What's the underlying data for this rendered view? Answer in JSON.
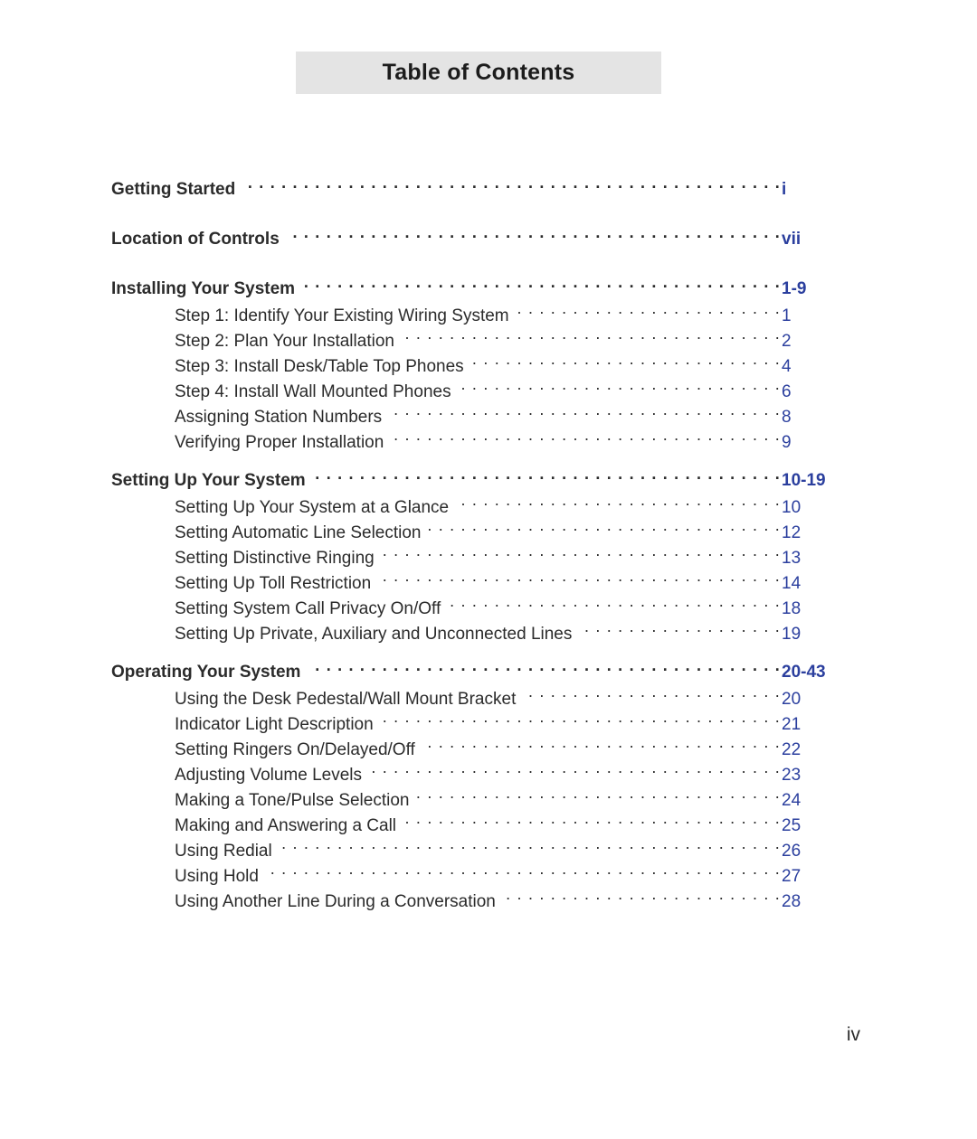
{
  "document": {
    "title": "Table of Contents",
    "footer_page_label": "iv",
    "accent_color": "#2b3f9e",
    "text_color": "#2b2b2b",
    "banner_background": "#e4e4e4",
    "leader_style": "dotted"
  },
  "toc": {
    "groups": [
      {
        "standalone": true,
        "heading": {
          "label": "Getting Started",
          "page": "i"
        },
        "items": []
      },
      {
        "standalone": true,
        "heading": {
          "label": "Location of Controls",
          "page": "vii"
        },
        "items": []
      },
      {
        "standalone": false,
        "heading": {
          "label": "Installing Your System",
          "page": "1-9"
        },
        "items": [
          {
            "label": "Step 1: Identify Your Existing Wiring System",
            "page": "1"
          },
          {
            "label": "Step 2: Plan Your Installation",
            "page": "2"
          },
          {
            "label": "Step 3: Install Desk/Table Top Phones",
            "page": "4"
          },
          {
            "label": "Step 4: Install Wall Mounted Phones",
            "page": "6"
          },
          {
            "label": "Assigning Station Numbers",
            "page": "8"
          },
          {
            "label": "Verifying Proper Installation",
            "page": "9"
          }
        ]
      },
      {
        "standalone": false,
        "heading": {
          "label": "Setting Up Your System",
          "page": "10-19"
        },
        "items": [
          {
            "label": "Setting Up Your System at a Glance",
            "page": "10"
          },
          {
            "label": "Setting Automatic Line Selection",
            "page": "12"
          },
          {
            "label": "Setting Distinctive Ringing",
            "page": "13"
          },
          {
            "label": "Setting Up Toll Restriction",
            "page": "14"
          },
          {
            "label": "Setting System Call Privacy On/Off",
            "page": "18"
          },
          {
            "label": "Setting Up Private, Auxiliary and Unconnected Lines",
            "page": "19"
          }
        ]
      },
      {
        "standalone": false,
        "heading": {
          "label": "Operating Your System",
          "page": "20-43"
        },
        "items": [
          {
            "label": "Using the Desk Pedestal/Wall Mount Bracket",
            "page": "20"
          },
          {
            "label": "Indicator Light Description",
            "page": "21"
          },
          {
            "label": "Setting Ringers On/Delayed/Off",
            "page": "22"
          },
          {
            "label": "Adjusting Volume Levels",
            "page": "23"
          },
          {
            "label": "Making a Tone/Pulse Selection",
            "page": "24"
          },
          {
            "label": "Making and Answering a Call",
            "page": "25"
          },
          {
            "label": "Using Redial",
            "page": "26"
          },
          {
            "label": "Using Hold",
            "page": "27"
          },
          {
            "label": "Using Another Line During a Conversation",
            "page": "28"
          }
        ]
      }
    ]
  }
}
